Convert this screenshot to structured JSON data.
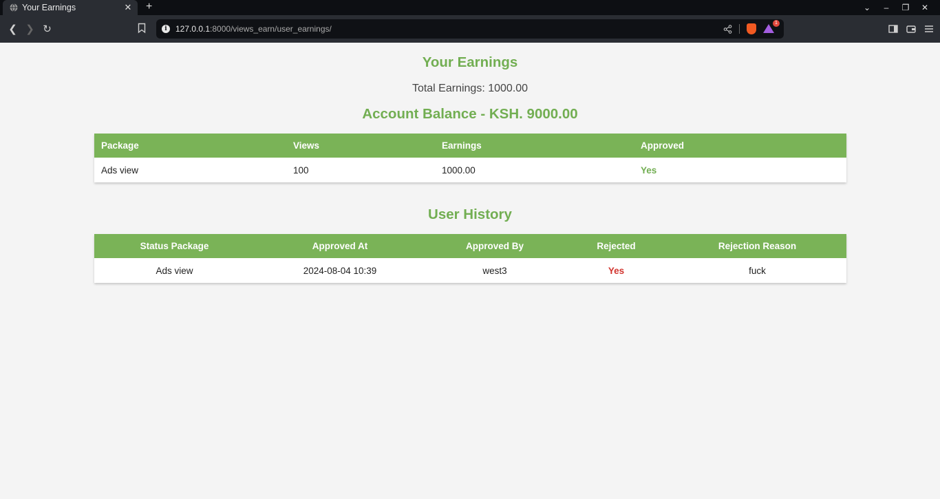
{
  "browser": {
    "tab_title": "Your Earnings",
    "new_tab": "+",
    "url_host": "127.0.0.1",
    "url_port_path": ":8000/views_earn/user_earnings/",
    "rewards_badge": "1"
  },
  "page": {
    "title": "Your Earnings",
    "total_earnings": "Total Earnings: 1000.00",
    "account_balance": "Account Balance - KSH. 9000.00"
  },
  "earnings_table": {
    "headers": [
      "Package",
      "Views",
      "Earnings",
      "Approved"
    ],
    "rows": [
      {
        "package": "Ads view",
        "views": "100",
        "earnings": "1000.00",
        "approved": "Yes"
      }
    ]
  },
  "history": {
    "title": "User History",
    "headers": [
      "Status Package",
      "Approved At",
      "Approved By",
      "Rejected",
      "Rejection Reason"
    ],
    "rows": [
      {
        "package": "Ads view",
        "approved_at": "2024-08-04 10:39",
        "approved_by": "west3",
        "rejected": "Yes",
        "reason": "fuck"
      }
    ]
  },
  "colors": {
    "accent_green": "#72ae52",
    "header_green": "#7ab357",
    "reject_red": "#d2352f"
  }
}
